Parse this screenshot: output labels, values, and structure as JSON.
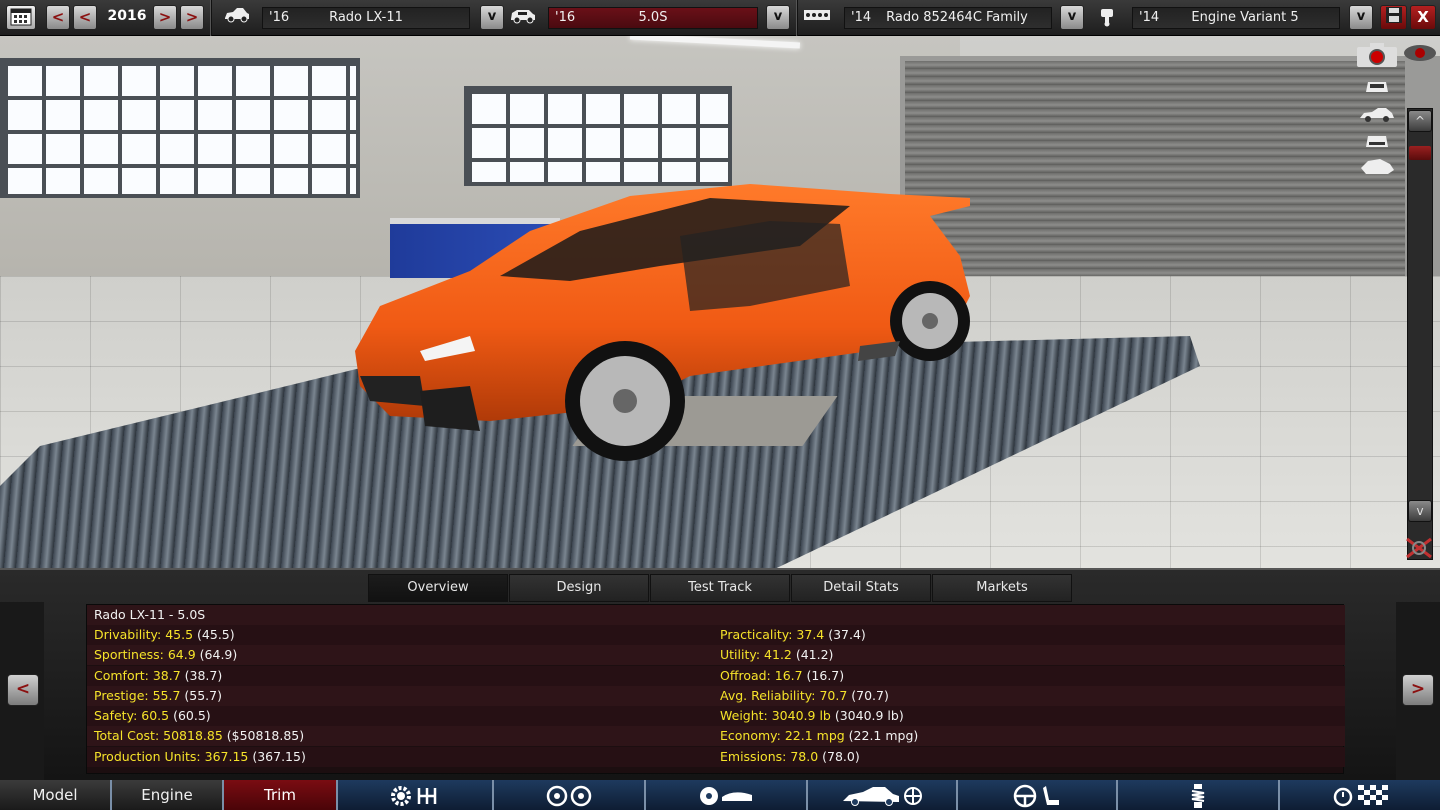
{
  "topbar": {
    "year": "2016",
    "prev_label": "<",
    "next_label": ">",
    "model": {
      "year": "'16",
      "name": "Rado LX-11"
    },
    "trim": {
      "year": "'16",
      "name": "5.0S"
    },
    "engine_family": {
      "year": "'14",
      "name": "Rado 852464C Family"
    },
    "engine_variant": {
      "year": "'14",
      "name": "Engine Variant 5"
    },
    "dropdown_label": "v",
    "close_label": "X"
  },
  "scroll": {
    "up_label": "^",
    "down_label": "v"
  },
  "tabs": [
    "Overview",
    "Design",
    "Test Track",
    "Detail Stats",
    "Markets"
  ],
  "panel": {
    "title": "Rado LX-11 - 5.0S",
    "prev_label": "<",
    "next_label": ">",
    "left_stats": [
      {
        "label": "Drivability: 45.5",
        "paren": " (45.5)"
      },
      {
        "label": "Sportiness: 64.9",
        "paren": " (64.9)"
      },
      {
        "label": "Comfort: 38.7",
        "paren": " (38.7)"
      },
      {
        "label": "Prestige: 55.7",
        "paren": " (55.7)"
      },
      {
        "label": "Safety: 60.5",
        "paren": " (60.5)"
      },
      {
        "label": "Total Cost: 50818.85",
        "paren": " ($50818.85)"
      },
      {
        "label": "Production Units: 367.15",
        "paren": " (367.15)"
      }
    ],
    "right_stats": [
      {
        "label": "Practicality: 37.4",
        "paren": " (37.4)"
      },
      {
        "label": "Utility: 41.2",
        "paren": " (41.2)"
      },
      {
        "label": "Offroad: 16.7",
        "paren": " (16.7)"
      },
      {
        "label": "Avg. Reliability: 70.7",
        "paren": " (70.7)"
      },
      {
        "label": "Weight: 3040.9 lb",
        "paren": " (3040.9 lb)"
      },
      {
        "label": "Economy: 22.1 mpg",
        "paren": " (22.1 mpg)"
      },
      {
        "label": "Emissions: 78.0",
        "paren": " (78.0)"
      }
    ]
  },
  "bottomnav": {
    "model": "Model",
    "engine": "Engine",
    "trim": "Trim"
  },
  "colors": {
    "accent_red": "#8b1010",
    "stat_yellow": "#f6e32a",
    "car_orange": "#f05a14",
    "nav_blue": "#1e3a5e"
  }
}
